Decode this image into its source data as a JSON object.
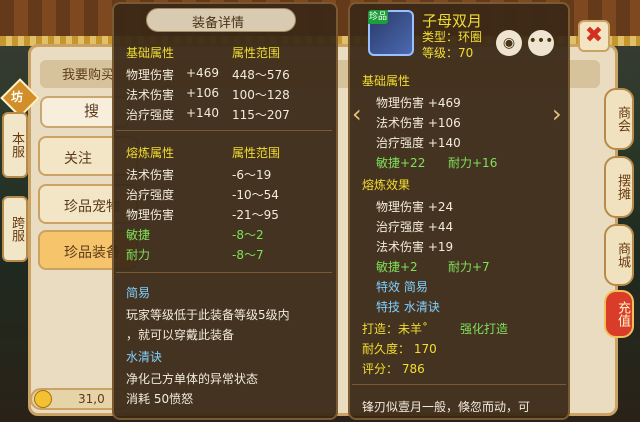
{
  "background": {
    "shop_title": "我要购买",
    "search_label": "搜",
    "categories": [
      "关注",
      "珍品宠物",
      "珍品装备"
    ],
    "side_tabs": [
      "本服",
      "跨服"
    ],
    "side_badge": "坊",
    "right_tabs": [
      "商会",
      "摆摊",
      "商城",
      "充值"
    ],
    "coin_value": "31,0",
    "close_label": "✖"
  },
  "left_panel": {
    "title": "装备详情",
    "base": {
      "header": "基础属性",
      "range_header": "属性范围",
      "rows": [
        {
          "name": "物理伤害",
          "value": "+469",
          "range": "448～576"
        },
        {
          "name": "法术伤害",
          "value": "+106",
          "range": "100～128"
        },
        {
          "name": "治疗强度",
          "value": "+140",
          "range": "115～207"
        }
      ]
    },
    "refine": {
      "header": "熔炼属性",
      "range_header": "属性范围",
      "rows": [
        {
          "name": "法术伤害",
          "range": "-6～19",
          "color": "w"
        },
        {
          "name": "治疗强度",
          "range": "-10～54",
          "color": "w"
        },
        {
          "name": "物理伤害",
          "range": "-21～95",
          "color": "w"
        },
        {
          "name": "敏捷",
          "range": "-8～2",
          "color": "g"
        },
        {
          "name": "耐力",
          "range": "-8～7",
          "color": "g"
        }
      ]
    },
    "special1": {
      "name": "简易",
      "desc_line1": "玩家等级低于此装备等级5级内",
      "desc_line2": "，就可以穿戴此装备"
    },
    "special2": {
      "name": "水清诀",
      "desc_line1": "净化己方单体的异常状态",
      "desc_line2": "消耗  50愤怒"
    }
  },
  "right_panel": {
    "item_name": "子母双月",
    "icon_tag": "珍品",
    "type_line": "类型：环圈",
    "level_line": "等级：70",
    "eye_icon": "eye-icon",
    "more_icon": "more-icon",
    "base_header": "基础属性",
    "base_rows": [
      {
        "text": "物理伤害 +469"
      },
      {
        "text": "法术伤害 +106"
      },
      {
        "text": "治疗强度 +140"
      }
    ],
    "base_green": [
      "敏捷+22",
      "耐力+16"
    ],
    "refine_header": "熔炼效果",
    "refine_rows": [
      {
        "text": "物理伤害 +24"
      },
      {
        "text": "治疗强度 +44"
      },
      {
        "text": "法术伤害 +19"
      }
    ],
    "refine_green": [
      "敏捷+2",
      "耐力+7"
    ],
    "special_effect": "特效  简易",
    "special_skill": "特技  水清诀",
    "forge": "打造：未羊˚",
    "forge_enhance": "强化打造",
    "durability": "耐久度：  170",
    "score": "评分：  786",
    "flavor": "锋刃似壹月一般，倏忽而动，可"
  }
}
